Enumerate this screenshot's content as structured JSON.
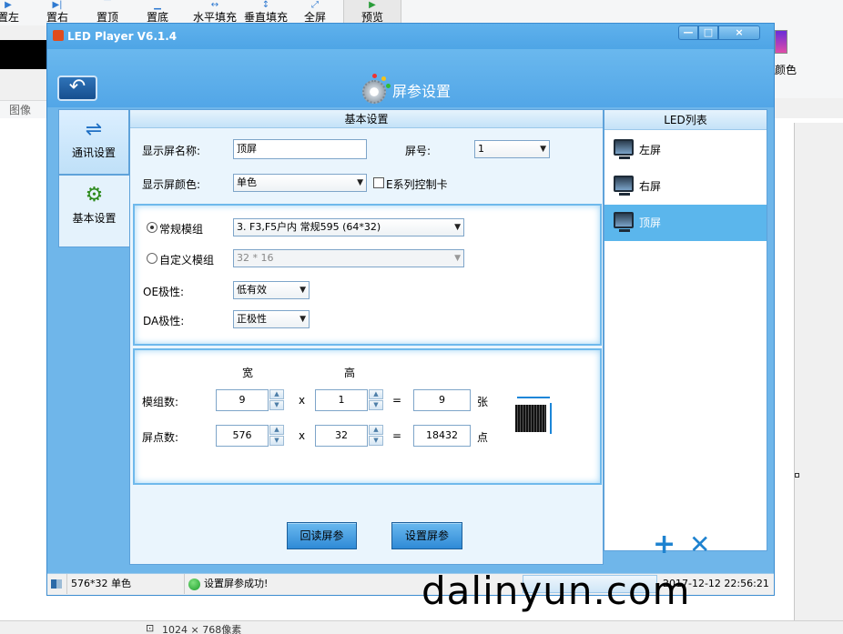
{
  "bg_app": {
    "toolbar": [
      {
        "icon": "align-left-icon",
        "label": "置左"
      },
      {
        "icon": "align-right-icon",
        "label": "置右"
      },
      {
        "icon": "align-top-icon",
        "label": "置顶"
      },
      {
        "icon": "align-bottom-icon",
        "label": "置底"
      },
      {
        "icon": "fill-horizontal-icon",
        "label": "水平填充"
      },
      {
        "icon": "fill-vertical-icon",
        "label": "垂直填充"
      },
      {
        "icon": "fullscreen-icon",
        "label": "全屏"
      },
      {
        "icon": "preview-icon",
        "label": "预览"
      }
    ],
    "ribbon_group": "图像",
    "color_label": "颜色",
    "status_size": "1024 × 768像素"
  },
  "window": {
    "title": "LED Player V6.1.4",
    "header": "屏参设置",
    "buttons": {
      "minimize": "—",
      "maximize": "□",
      "close": "×"
    }
  },
  "nav": [
    {
      "icon": "usb-icon",
      "label": "通讯设置"
    },
    {
      "icon": "gears-icon",
      "label": "基本设置"
    }
  ],
  "basic": {
    "header": "基本设置",
    "screen_name_label": "显示屏名称:",
    "screen_name_value": "顶屏",
    "screen_no_label": "屏号:",
    "screen_no_value": "1",
    "color_label": "显示屏颜色:",
    "color_value": "单色",
    "e_series_label": "E系列控制卡",
    "module_normal_label": "常规模组",
    "module_normal_value": "3. F3,F5户内 常规595 (64*32)",
    "module_custom_label": "自定义模组",
    "module_custom_value": "32 * 16",
    "oe_label": "OE极性:",
    "oe_value": "低有效",
    "da_label": "DA极性:",
    "da_value": "正极性",
    "width_header": "宽",
    "height_header": "高",
    "module_count_label": "模组数:",
    "module_w": "9",
    "module_h": "1",
    "module_total": "9",
    "module_unit": "张",
    "pixel_count_label": "屏点数:",
    "pixel_w": "576",
    "pixel_h": "32",
    "pixel_total": "18432",
    "pixel_unit": "点",
    "times": "x",
    "equals": "=",
    "read_button": "回读屏参",
    "set_button": "设置屏参"
  },
  "led_list": {
    "header": "LED列表",
    "items": [
      "左屏",
      "右屏",
      "顶屏"
    ],
    "selected": "顶屏",
    "add": "+",
    "delete": "✕"
  },
  "status": {
    "size_text": "576*32 单色",
    "message": "设置屏参成功!",
    "datetime": "2017-12-12 22:56:21"
  },
  "watermark": "dalinyun.com"
}
